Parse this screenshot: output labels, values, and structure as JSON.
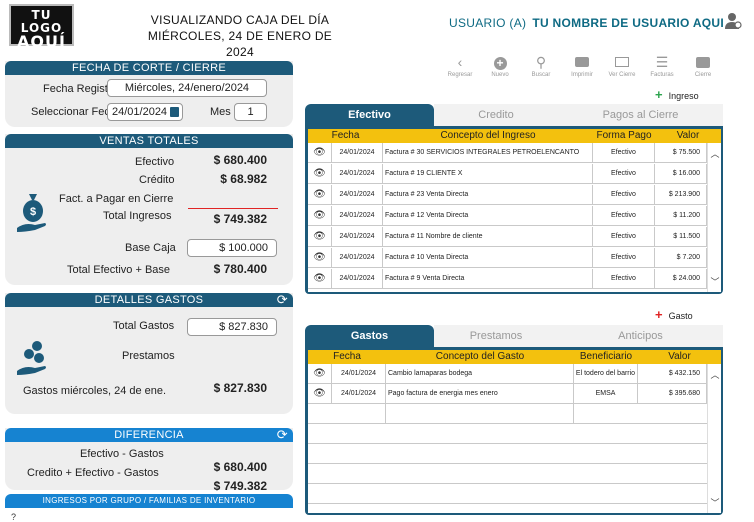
{
  "header": {
    "logo_line1": "TU LOGO",
    "logo_line2": "AQUÍ",
    "title_line1": "VISUALIZANDO CAJA DEL DÍA",
    "title_line2": "MIÉRCOLES, 24 DE ENERO DE 2024",
    "user_prefix": "USUARIO (A)",
    "user_name": "TU NOMBRE DE USUARIO AQUI",
    "user_icon": "user-icon"
  },
  "fecha_corte": {
    "title": "FECHA DE CORTE / CIERRE",
    "fecha_registro_label": "Fecha Registro",
    "fecha_registro_value": "Miércoles,  24/enero/2024",
    "seleccionar_fecha_label": "Seleccionar Fecha",
    "seleccionar_fecha_value": "24/01/2024",
    "mes_label": "Mes",
    "mes_value": "1"
  },
  "ventas": {
    "title": "VENTAS TOTALES",
    "efectivo_label": "Efectivo",
    "efectivo_value": "$ 680.400",
    "credito_label": "Crédito",
    "credito_value": "$ 68.982",
    "fact_label": "Fact. a Pagar en Cierre",
    "total_ingresos_label": "Total Ingresos",
    "total_ingresos_value": "$ 749.382",
    "base_caja_label": "Base Caja",
    "base_caja_value": "$ 100.000",
    "total_efectivo_base_label": "Total Efectivo + Base",
    "total_efectivo_base_value": "$ 780.400"
  },
  "gastos_panel": {
    "title": "DETALLES GASTOS",
    "total_gastos_label": "Total Gastos",
    "total_gastos_value": "$ 827.830",
    "prestamos_label": "Prestamos",
    "gastos_dia_label": "Gastos  miércoles, 24 de ene.",
    "gastos_dia_value": "$ 827.830"
  },
  "diferencia": {
    "title": "DIFERENCIA",
    "efectivo_gastos_label": "Efectivo - Gastos",
    "efectivo_gastos_value": "$ 680.400",
    "credito_efectivo_gastos_label": "Credito + Efectivo - Gastos",
    "credito_efectivo_gastos_value": "$ 749.382"
  },
  "bottom_bar": "INGRESOS POR GRUPO / FAMILIAS DE INVENTARIO",
  "bottom_help": "?",
  "toolbar": [
    {
      "label": "Regresar",
      "icon": "back-icon"
    },
    {
      "label": "Nuevo",
      "icon": "plus-icon"
    },
    {
      "label": "Buscar",
      "icon": "search-icon"
    },
    {
      "label": "Imprimir",
      "icon": "print-icon"
    },
    {
      "label": "Ver Cierre",
      "icon": "view-close-icon"
    },
    {
      "label": "Facturas",
      "icon": "list-icon"
    },
    {
      "label": "Cierre",
      "icon": "register-icon"
    }
  ],
  "ingreso_link": "Ingreso",
  "gasto_link": "Gasto",
  "ingresos_tabs": [
    "Efectivo",
    "Credito",
    "Pagos al Cierre"
  ],
  "ingresos_headers": [
    "Fecha",
    "Concepto del Ingreso",
    "Forma Pago",
    "Valor"
  ],
  "ingresos_rows": [
    {
      "fecha": "24/01/2024",
      "concepto": "Factura # 30 SERVICIOS INTEGRALES PETROELENCANTO",
      "forma": "Efectivo",
      "valor": "$ 75.500"
    },
    {
      "fecha": "24/01/2024",
      "concepto": "Factura # 19 CLIENTE X",
      "forma": "Efectivo",
      "valor": "$ 16.000"
    },
    {
      "fecha": "24/01/2024",
      "concepto": "Factura # 23 Venta Directa",
      "forma": "Efectivo",
      "valor": "$ 213.900"
    },
    {
      "fecha": "24/01/2024",
      "concepto": "Factura # 12 Venta Directa",
      "forma": "Efectivo",
      "valor": "$ 11.200"
    },
    {
      "fecha": "24/01/2024",
      "concepto": "Factura # 11 Nombre de cliente",
      "forma": "Efectivo",
      "valor": "$ 11.500"
    },
    {
      "fecha": "24/01/2024",
      "concepto": "Factura # 10 Venta Directa",
      "forma": "Efectivo",
      "valor": "$ 7.200"
    },
    {
      "fecha": "24/01/2024",
      "concepto": "Factura # 9 Venta Directa",
      "forma": "Efectivo",
      "valor": "$ 24.000"
    }
  ],
  "gastos_tabs": [
    "Gastos",
    "Prestamos",
    "Anticipos"
  ],
  "gastos_headers": [
    "Fecha",
    "Concepto del Gasto",
    "Beneficiario",
    "Valor"
  ],
  "gastos_rows": [
    {
      "fecha": "24/01/2024",
      "concepto": "Cambio lamaparas bodega",
      "beneficiario": "El todero del barrio",
      "valor": "$ 432.150"
    },
    {
      "fecha": "24/01/2024",
      "concepto": "Pago factura de energia mes enero",
      "beneficiario": "EMSA",
      "valor": "$ 395.680"
    }
  ],
  "colors": {
    "panel_head": "#1d5a7a",
    "panel_head_light": "#1683d1",
    "grid_header": "#f3c10e",
    "user_text": "#0e6a83",
    "plus_green": "#2ea44f",
    "plus_red": "#e02424"
  }
}
